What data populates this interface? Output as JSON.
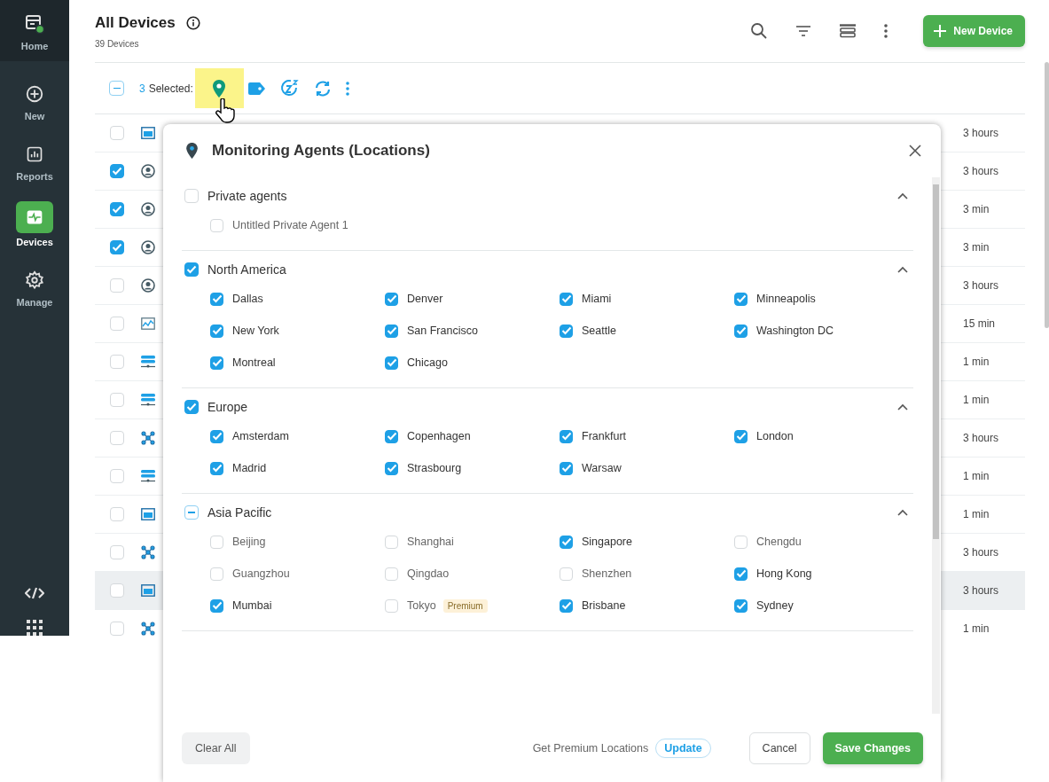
{
  "sidebar": {
    "items": [
      {
        "label": "Home",
        "selected": false
      },
      {
        "label": "New",
        "selected": false
      },
      {
        "label": "Reports",
        "selected": false
      },
      {
        "label": "Devices",
        "selected": true
      },
      {
        "label": "Manage",
        "selected": false
      }
    ]
  },
  "header": {
    "title": "All Devices",
    "subtitle": "39 Devices",
    "new_button": "New Device"
  },
  "toolbar": {
    "partial": true,
    "count": "3",
    "label": "Selected:"
  },
  "table": {
    "rows": [
      {
        "checked": false,
        "hovered": false,
        "kind": "web",
        "time": "3 hours"
      },
      {
        "checked": true,
        "hovered": false,
        "kind": "user",
        "time": "3 hours"
      },
      {
        "checked": true,
        "hovered": false,
        "kind": "user",
        "time": "3 min"
      },
      {
        "checked": true,
        "hovered": false,
        "kind": "user",
        "time": "3 min"
      },
      {
        "checked": false,
        "hovered": false,
        "kind": "user",
        "time": "3 hours"
      },
      {
        "checked": false,
        "hovered": false,
        "kind": "chart",
        "time": "15 min"
      },
      {
        "checked": false,
        "hovered": false,
        "kind": "server",
        "time": "1 min"
      },
      {
        "checked": false,
        "hovered": false,
        "kind": "server",
        "time": "1 min"
      },
      {
        "checked": false,
        "hovered": false,
        "kind": "network",
        "time": "3 hours"
      },
      {
        "checked": false,
        "hovered": false,
        "kind": "server",
        "time": "1 min"
      },
      {
        "checked": false,
        "hovered": false,
        "kind": "web",
        "time": "1 min"
      },
      {
        "checked": false,
        "hovered": false,
        "kind": "network",
        "time": "3 hours"
      },
      {
        "checked": false,
        "hovered": true,
        "kind": "web",
        "time": "3 hours"
      },
      {
        "checked": false,
        "hovered": false,
        "kind": "network",
        "time": "1 min"
      }
    ]
  },
  "dialog": {
    "title": "Monitoring Agents (Locations)",
    "groups": [
      {
        "name": "Private agents",
        "checked": false,
        "partial": false,
        "expanded": true,
        "items": [
          {
            "name": "Untitled Private Agent 1",
            "checked": false
          }
        ]
      },
      {
        "name": "North America",
        "checked": true,
        "partial": false,
        "expanded": true,
        "items": [
          {
            "name": "Dallas",
            "checked": true
          },
          {
            "name": "Denver",
            "checked": true
          },
          {
            "name": "Miami",
            "checked": true
          },
          {
            "name": "Minneapolis",
            "checked": true
          },
          {
            "name": "New York",
            "checked": true
          },
          {
            "name": "San Francisco",
            "checked": true
          },
          {
            "name": "Seattle",
            "checked": true
          },
          {
            "name": "Washington DC",
            "checked": true
          },
          {
            "name": "Montreal",
            "checked": true
          },
          {
            "name": "Chicago",
            "checked": true
          }
        ]
      },
      {
        "name": "Europe",
        "checked": true,
        "partial": false,
        "expanded": true,
        "items": [
          {
            "name": "Amsterdam",
            "checked": true
          },
          {
            "name": "Copenhagen",
            "checked": true
          },
          {
            "name": "Frankfurt",
            "checked": true
          },
          {
            "name": "London",
            "checked": true
          },
          {
            "name": "Madrid",
            "checked": true
          },
          {
            "name": "Strasbourg",
            "checked": true
          },
          {
            "name": "Warsaw",
            "checked": true
          }
        ]
      },
      {
        "name": "Asia Pacific",
        "checked": true,
        "partial": true,
        "expanded": true,
        "items": [
          {
            "name": "Beijing",
            "checked": false
          },
          {
            "name": "Shanghai",
            "checked": false
          },
          {
            "name": "Singapore",
            "checked": true
          },
          {
            "name": "Chengdu",
            "checked": false
          },
          {
            "name": "Guangzhou",
            "checked": false
          },
          {
            "name": "Qingdao",
            "checked": false
          },
          {
            "name": "Shenzhen",
            "checked": false
          },
          {
            "name": "Hong Kong",
            "checked": true
          },
          {
            "name": "Mumbai",
            "checked": true
          },
          {
            "name": "Tokyo",
            "checked": false,
            "badge": "Premium"
          },
          {
            "name": "Brisbane",
            "checked": true
          },
          {
            "name": "Sydney",
            "checked": true
          }
        ]
      }
    ],
    "clear_button": "Clear All",
    "premium_text": "Get Premium Locations",
    "update_button": "Update",
    "cancel_button": "Cancel",
    "save_button": "Save Changes"
  }
}
